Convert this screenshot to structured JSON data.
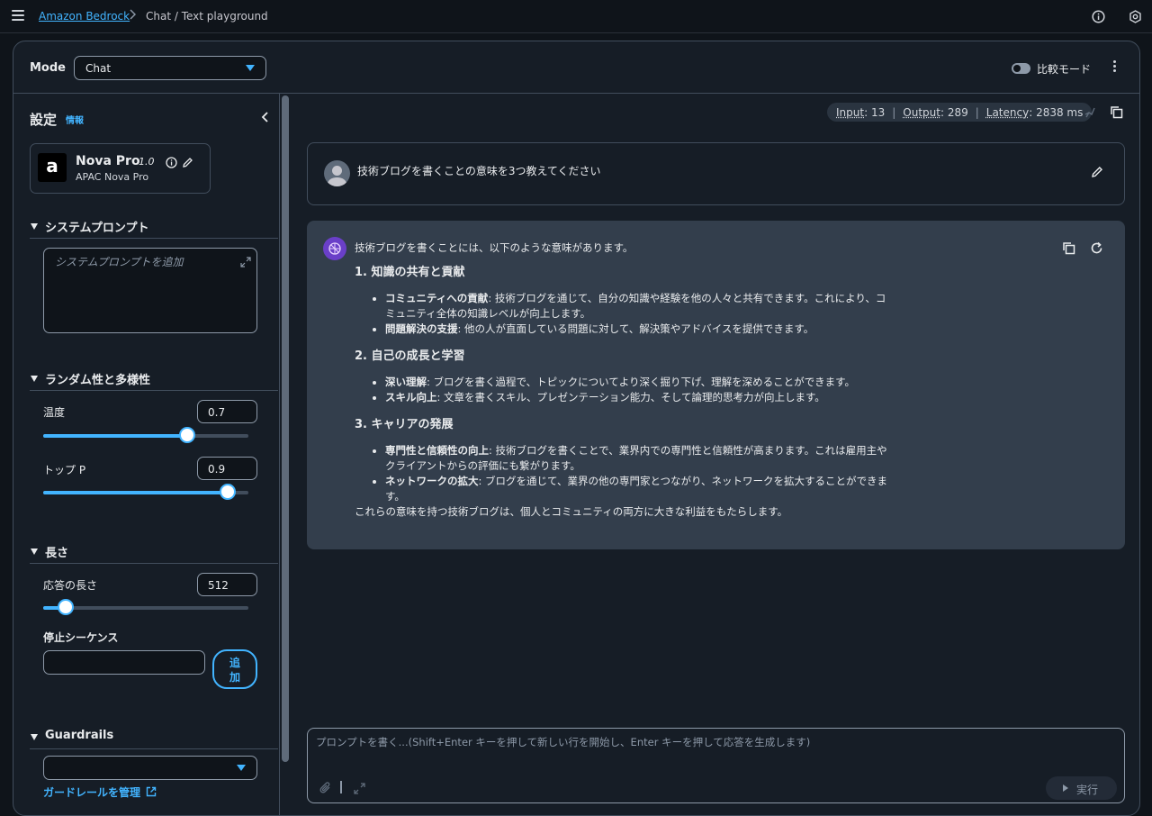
{
  "breadcrumb": {
    "root": "Amazon Bedrock",
    "separator": ">",
    "current": "Chat / Text playground"
  },
  "mode": {
    "label": "Mode",
    "value": "Chat"
  },
  "compare": {
    "label": "比較モード",
    "enabled": false
  },
  "settings": {
    "title": "設定",
    "info": "情報",
    "model": {
      "name": "Nova Pro",
      "version": "1.0",
      "subtitle": "APAC Nova Pro",
      "logo": "a"
    },
    "system_prompt": {
      "heading": "システムプロンプト",
      "placeholder": "システムプロンプトを追加"
    },
    "randomness": {
      "heading": "ランダム性と多様性",
      "temperature": {
        "label": "温度",
        "value": "0.7",
        "fraction": 0.7
      },
      "top_p": {
        "label": "トップ P",
        "value": "0.9",
        "fraction": 0.9
      }
    },
    "length": {
      "heading": "長さ",
      "response_length": {
        "label": "応答の長さ",
        "value": "512",
        "fraction": 0.11
      },
      "stop_sequences": {
        "label": "停止シーケンス",
        "value": "",
        "add_label_1": "追",
        "add_label_2": "加"
      }
    },
    "guardrails": {
      "heading": "Guardrails",
      "value": "",
      "manage_link": "ガードレールを管理"
    }
  },
  "stats": {
    "input_key": "Input",
    "input_val": "13",
    "output_key": "Output",
    "output_val": "289",
    "latency_key": "Latency",
    "latency_val": "2838 ms"
  },
  "conversation": {
    "user_message": "技術ブログを書くことの意味を3つ教えてください",
    "assistant": {
      "intro": "技術ブログを書くことには、以下のような意味があります。",
      "sections": [
        {
          "title": "1. 知識の共有と貢献",
          "items": [
            {
              "term": "コミュニティへの貢献",
              "text": ": 技術ブログを通じて、自分の知識や経験を他の人々と共有できます。これにより、コミュニティ全体の知識レベルが向上します。"
            },
            {
              "term": "問題解決の支援",
              "text": ": 他の人が直面している問題に対して、解決策やアドバイスを提供できます。"
            }
          ]
        },
        {
          "title": "2. 自己の成長と学習",
          "items": [
            {
              "term": "深い理解",
              "text": ": ブログを書く過程で、トピックについてより深く掘り下げ、理解を深めることができます。"
            },
            {
              "term": "スキル向上",
              "text": ": 文章を書くスキル、プレゼンテーション能力、そして論理的思考力が向上します。"
            }
          ]
        },
        {
          "title": "3. キャリアの発展",
          "items": [
            {
              "term": "専門性と信頼性の向上",
              "text": ": 技術ブログを書くことで、業界内での専門性と信頼性が高まります。これは雇用主やクライアントからの評価にも繋がります。"
            },
            {
              "term": "ネットワークの拡大",
              "text": ": ブログを通じて、業界の他の専門家とつながり、ネットワークを拡大することができます。"
            }
          ]
        }
      ],
      "conclusion": "これらの意味を持つ技術ブログは、個人とコミュニティの両方に大きな利益をもたらします。"
    }
  },
  "prompt": {
    "placeholder": "プロンプトを書く...(Shift+Enter キーを押して新しい行を開始し、Enter キーを押して応答を生成します)",
    "run_label": "実行"
  },
  "colors": {
    "accent": "#42b4ff",
    "background": "#0f141a",
    "panel": "#161d26",
    "assistant_bubble": "#333e4c"
  }
}
